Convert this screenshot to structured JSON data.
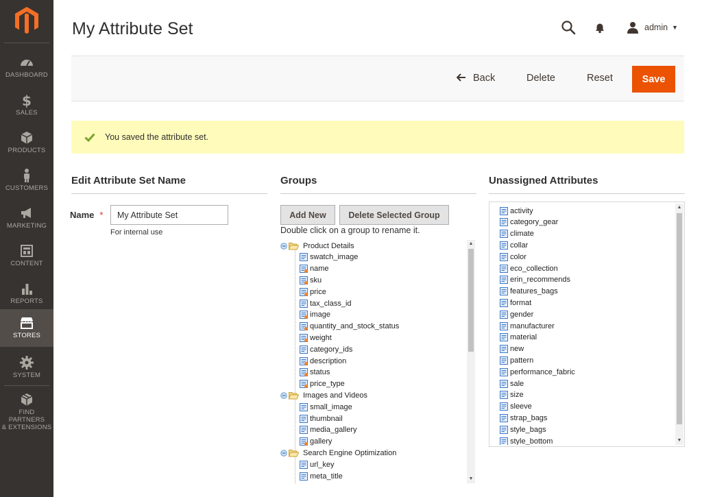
{
  "sidebar": {
    "items": [
      {
        "label": "DASHBOARD",
        "icon": "dashboard-icon"
      },
      {
        "label": "SALES",
        "icon": "dollar-icon"
      },
      {
        "label": "PRODUCTS",
        "icon": "cube-icon"
      },
      {
        "label": "CUSTOMERS",
        "icon": "person-icon"
      },
      {
        "label": "MARKETING",
        "icon": "megaphone-icon"
      },
      {
        "label": "CONTENT",
        "icon": "layout-icon"
      },
      {
        "label": "REPORTS",
        "icon": "bar-chart-icon"
      },
      {
        "label": "STORES",
        "icon": "store-icon"
      },
      {
        "label": "SYSTEM",
        "icon": "gear-icon"
      },
      {
        "label": "FIND PARTNERS",
        "label2": "& EXTENSIONS",
        "icon": "box-icon"
      }
    ],
    "active": "STORES"
  },
  "header": {
    "title": "My Attribute Set",
    "user": "admin"
  },
  "actions": {
    "back": "Back",
    "delete": "Delete",
    "reset": "Reset",
    "save": "Save"
  },
  "message": {
    "text": "You saved the attribute set."
  },
  "edit_section": {
    "title": "Edit Attribute Set Name",
    "name_label": "Name",
    "required_mark": "*",
    "name_value": "My Attribute Set",
    "note": "For internal use"
  },
  "groups_section": {
    "title": "Groups",
    "add_new": "Add New",
    "delete_group": "Delete Selected Group",
    "hint": "Double click on a group to rename it.",
    "tree": [
      {
        "group": "Product Details",
        "attributes": [
          {
            "name": "swatch_image",
            "system": false
          },
          {
            "name": "name",
            "system": true
          },
          {
            "name": "sku",
            "system": true
          },
          {
            "name": "price",
            "system": true
          },
          {
            "name": "tax_class_id",
            "system": false
          },
          {
            "name": "image",
            "system": true
          },
          {
            "name": "quantity_and_stock_status",
            "system": true
          },
          {
            "name": "weight",
            "system": true
          },
          {
            "name": "category_ids",
            "system": false
          },
          {
            "name": "description",
            "system": true
          },
          {
            "name": "status",
            "system": true
          },
          {
            "name": "price_type",
            "system": true
          }
        ]
      },
      {
        "group": "Images and Videos",
        "attributes": [
          {
            "name": "small_image",
            "system": false
          },
          {
            "name": "thumbnail",
            "system": false
          },
          {
            "name": "media_gallery",
            "system": false
          },
          {
            "name": "gallery",
            "system": true
          }
        ]
      },
      {
        "group": "Search Engine Optimization",
        "attributes": [
          {
            "name": "url_key",
            "system": false
          },
          {
            "name": "meta_title",
            "system": false
          }
        ]
      }
    ]
  },
  "unassigned_section": {
    "title": "Unassigned Attributes",
    "attributes": [
      "activity",
      "category_gear",
      "climate",
      "collar",
      "color",
      "eco_collection",
      "erin_recommends",
      "features_bags",
      "format",
      "gender",
      "manufacturer",
      "material",
      "new",
      "pattern",
      "performance_fabric",
      "sale",
      "size",
      "sleeve",
      "strap_bags",
      "style_bags",
      "style_bottom"
    ]
  },
  "colors": {
    "sidebar_bg": "#373330",
    "accent_orange": "#eb5202",
    "message_bg": "#fffbbb",
    "success_green": "#79a22e"
  }
}
